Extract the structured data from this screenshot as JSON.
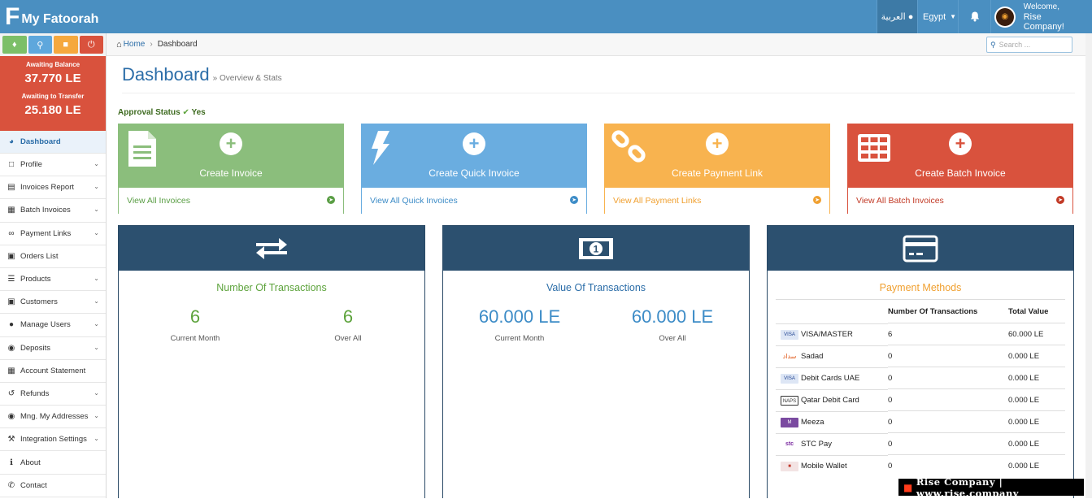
{
  "header": {
    "brand": "My Fatoorah",
    "language": "العربية",
    "country": "Egypt",
    "welcome": "Welcome,",
    "user_name": "Rise Company!"
  },
  "sidebar": {
    "balance": {
      "awaiting_label": "Awaiting Balance",
      "awaiting_value": "37.770 LE",
      "transfer_label": "Awaiting to Transfer",
      "transfer_value": "25.180 LE"
    },
    "items": [
      {
        "label": "Dashboard"
      },
      {
        "label": "Profile"
      },
      {
        "label": "Invoices Report"
      },
      {
        "label": "Batch Invoices"
      },
      {
        "label": "Payment Links"
      },
      {
        "label": "Orders List"
      },
      {
        "label": "Products"
      },
      {
        "label": "Customers"
      },
      {
        "label": "Manage Users"
      },
      {
        "label": "Deposits"
      },
      {
        "label": "Account Statement"
      },
      {
        "label": "Refunds"
      },
      {
        "label": "Mng. My Addresses"
      },
      {
        "label": "Integration Settings"
      },
      {
        "label": "About"
      },
      {
        "label": "Contact"
      }
    ]
  },
  "breadcrumb": {
    "home": "Home",
    "current": "Dashboard"
  },
  "search": {
    "placeholder": "Search ..."
  },
  "page": {
    "title": "Dashboard",
    "subtitle": "» Overview & Stats",
    "approval_label": "Approval Status",
    "approval_value": "Yes"
  },
  "tiles": [
    {
      "label": "Create Invoice",
      "link": "View All Invoices",
      "color": "#8bbe7c"
    },
    {
      "label": "Create Quick Invoice",
      "link": "View All Quick Invoices",
      "color": "#6aade0"
    },
    {
      "label": "Create Payment Link",
      "link": "View All Payment Links",
      "color": "#f8b34f"
    },
    {
      "label": "Create Batch Invoice",
      "link": "View All Batch Invoices",
      "color": "#d9523d"
    }
  ],
  "transactions": {
    "title": "Number Of Transactions",
    "current_value": "6",
    "current_label": "Current Month",
    "overall_value": "6",
    "overall_label": "Over All"
  },
  "value": {
    "title": "Value Of Transactions",
    "current_value": "60.000 LE",
    "current_label": "Current Month",
    "overall_value": "60.000 LE",
    "overall_label": "Over All"
  },
  "payment_methods": {
    "title": "Payment Methods",
    "col_transactions": "Number Of Transactions",
    "col_total": "Total Value",
    "rows": [
      {
        "name": "VISA/MASTER",
        "count": "6",
        "total": "60.000 LE"
      },
      {
        "name": "Sadad",
        "count": "0",
        "total": "0.000 LE"
      },
      {
        "name": "Debit Cards UAE",
        "count": "0",
        "total": "0.000 LE"
      },
      {
        "name": "Qatar Debit Card",
        "count": "0",
        "total": "0.000 LE"
      },
      {
        "name": "Meeza",
        "count": "0",
        "total": "0.000 LE"
      },
      {
        "name": "STC Pay",
        "count": "0",
        "total": "0.000 LE"
      },
      {
        "name": "Mobile Wallet",
        "count": "0",
        "total": "0.000 LE"
      }
    ]
  },
  "footer": {
    "text": "Rise Company | www.rise.company"
  }
}
